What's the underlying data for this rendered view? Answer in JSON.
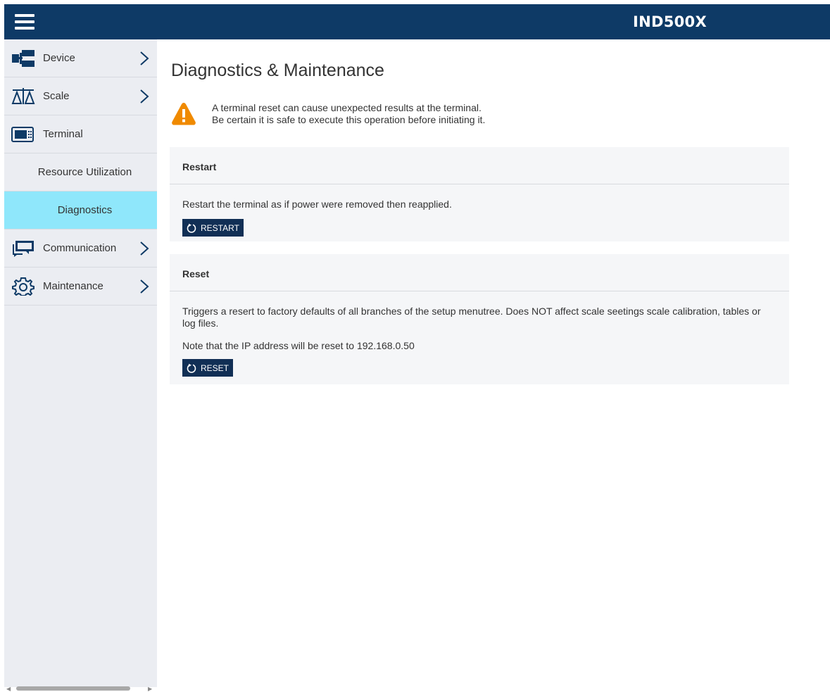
{
  "header": {
    "title": "IND500X"
  },
  "sidebar": {
    "items": [
      {
        "label": "Device",
        "icon": "device-tree-icon",
        "has_arrow": true
      },
      {
        "label": "Scale",
        "icon": "scale-balance-icon",
        "has_arrow": true
      },
      {
        "label": "Terminal",
        "icon": "terminal-display-icon",
        "has_arrow": false
      },
      {
        "label": "Resource Utilization",
        "sub": true
      },
      {
        "label": "Diagnostics",
        "sub": true,
        "active": true
      },
      {
        "label": "Communication",
        "icon": "chat-bubbles-icon",
        "has_arrow": true
      },
      {
        "label": "Maintenance",
        "icon": "gear-icon",
        "has_arrow": true
      }
    ]
  },
  "main": {
    "title": "Diagnostics & Maintenance",
    "warning": {
      "line1": "A terminal reset can cause unexpected results at the terminal.",
      "line2": "Be certain it is safe to execute this operation before initiating it."
    },
    "restart": {
      "heading": "Restart",
      "description": "Restart the terminal as if power were removed then reapplied.",
      "button": "RESTART"
    },
    "reset": {
      "heading": "Reset",
      "description": "Triggers a resert to factory defaults of all branches of the setup menutree. Does NOT affect scale seetings scale calibration, tables or log files.",
      "note": "Note that the IP address will be reset to 192.168.0.50",
      "button": "RESET"
    }
  },
  "colors": {
    "header_bg": "#0e3a66",
    "sidebar_bg": "#ebedf2",
    "active_item_bg": "#8fe7fb",
    "button_bg": "#112f55",
    "warning": "#f08a00"
  }
}
